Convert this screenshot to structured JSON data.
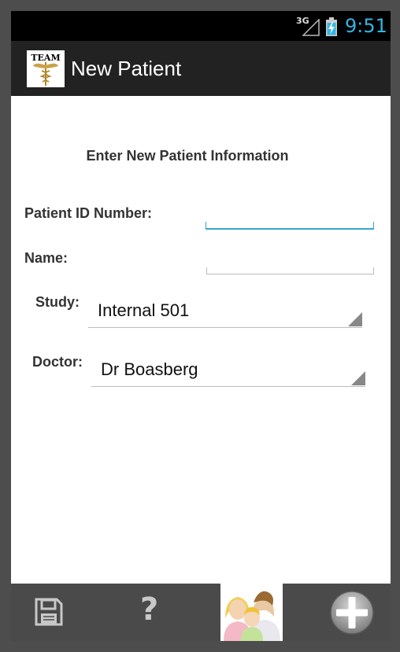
{
  "status_bar": {
    "network": "3G",
    "time": "9:51"
  },
  "action_bar": {
    "logo_text": "TEAM",
    "title": "New Patient"
  },
  "form": {
    "heading": "Enter New Patient Information",
    "patient_id_label": "Patient ID Number:",
    "patient_id_value": "",
    "name_label": "Name:",
    "name_value": "",
    "study_label": "Study:",
    "study_value": "Internal 501",
    "doctor_label": "Doctor:",
    "doctor_value": "Dr Boasberg"
  },
  "bottom_bar": {
    "icons": [
      "save-icon",
      "help-icon",
      "patients-icon",
      "add-icon"
    ],
    "help_glyph": "?"
  },
  "colors": {
    "accent": "#33b5e5",
    "action_bar": "#222222",
    "bottom_bar": "#4a4a4a"
  }
}
